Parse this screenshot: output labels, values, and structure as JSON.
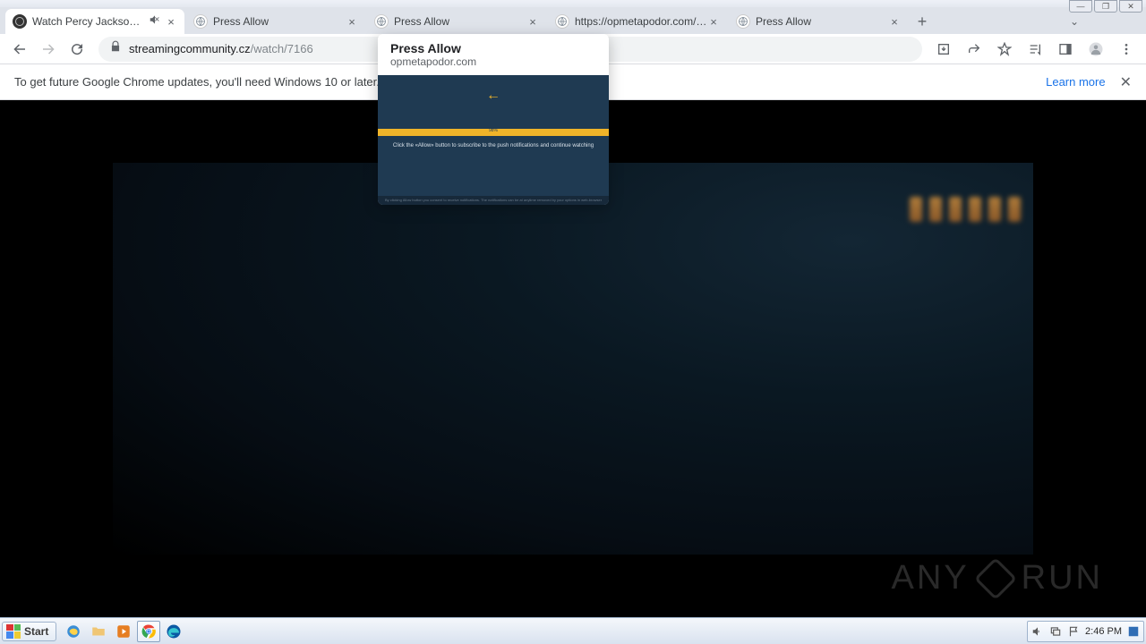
{
  "window_buttons": {
    "min": "—",
    "max": "❐",
    "close": "✕"
  },
  "tabs": [
    {
      "title": "Watch Percy Jackson e gli",
      "muted": true,
      "favicon": "sc"
    },
    {
      "title": "Press Allow",
      "favicon": "globe"
    },
    {
      "title": "Press Allow",
      "favicon": "globe"
    },
    {
      "title": "https://opmetapodor.com/?s=",
      "favicon": "globe"
    },
    {
      "title": "Press Allow",
      "favicon": "globe"
    }
  ],
  "omnibox": {
    "host": "streamingcommunity.cz",
    "path": "/watch/7166"
  },
  "infobar": {
    "text": "To get future Google Chrome updates, you'll need Windows 10 or later. T",
    "learn": "Learn more"
  },
  "hover": {
    "title": "Press Allow",
    "domain": "opmetapodor.com",
    "pct": "98%",
    "msg": "Click the «Allow» button to subscribe to the push notifications and continue watching",
    "foot": "By clicking Allow button you consent to receive notifications. The notifications can be at anytime removed by your options in web-browser notification…"
  },
  "watermark": {
    "left": "ANY",
    "right": "RUN"
  },
  "taskbar": {
    "start": "Start",
    "time": "2:46 PM"
  }
}
